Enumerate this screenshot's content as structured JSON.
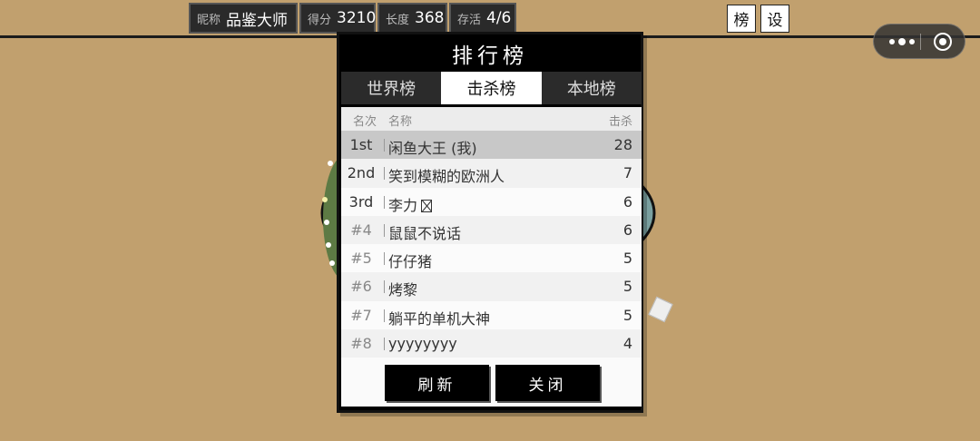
{
  "hud": {
    "nickname_label": "昵称",
    "nickname": "品鉴大师",
    "score_label": "得分",
    "score": "3210",
    "length_label": "长度",
    "length": "368",
    "alive_label": "存活",
    "alive": "4/6",
    "rank_button": "榜",
    "settings_button": "设"
  },
  "leaderboard": {
    "title": "排行榜",
    "tabs": [
      "世界榜",
      "击杀榜",
      "本地榜"
    ],
    "active_tab": "击杀榜",
    "columns": {
      "rank": "名次",
      "name": "名称",
      "kills": "击杀"
    },
    "rows": [
      {
        "rank": "1st",
        "name": "闲鱼大王 (我)",
        "kills": "28"
      },
      {
        "rank": "2nd",
        "name": "笑到模糊的欧洲人",
        "kills": "7"
      },
      {
        "rank": "3rd",
        "name": "李力",
        "kills": "6"
      },
      {
        "rank": "#4",
        "name": "鼠鼠不说话",
        "kills": "6"
      },
      {
        "rank": "#5",
        "name": "仔仔猪",
        "kills": "5"
      },
      {
        "rank": "#6",
        "name": "烤黎",
        "kills": "5"
      },
      {
        "rank": "#7",
        "name": "躺平的单机大神",
        "kills": "5"
      },
      {
        "rank": "#8",
        "name": "yyyyyyyy",
        "kills": "4"
      }
    ],
    "refresh_button": "刷新",
    "close_button": "关闭"
  },
  "colors": {
    "ground": "#c1a06e",
    "panel_bg": "#000000",
    "highlight_row": "#c8c8c8"
  }
}
